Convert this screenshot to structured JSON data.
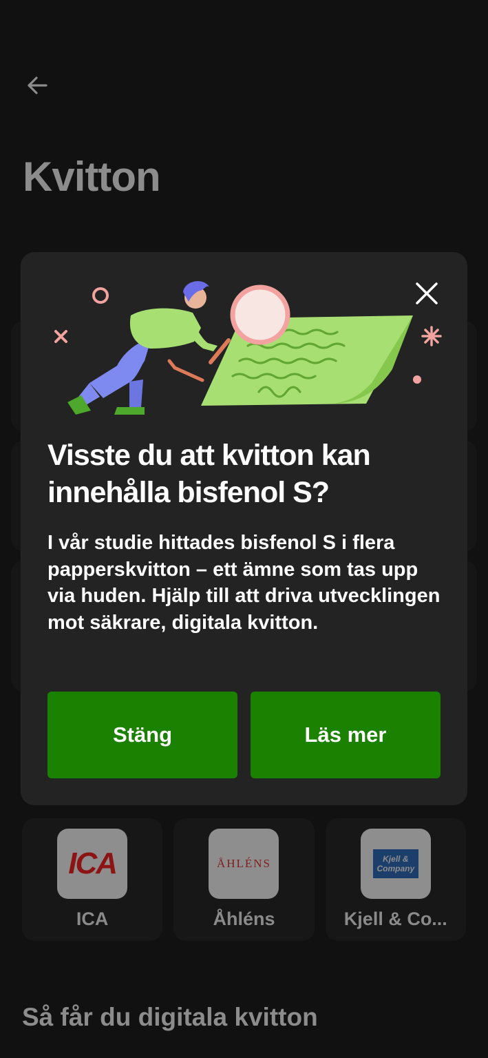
{
  "header": {
    "back_icon": "arrow-left-icon",
    "title": "Kvitton"
  },
  "stores": [
    {
      "name": "ICA",
      "logo_text": "ICA"
    },
    {
      "name": "Åhléns",
      "logo_text": "ÅHLÉNS"
    },
    {
      "name": "Kjell & Co...",
      "logo_line1": "Kjell &",
      "logo_line2": "Company"
    }
  ],
  "section": {
    "title": "Så får du digitala kvitton"
  },
  "modal": {
    "close_icon": "close-icon",
    "illustration": "person-with-magnifying-glass-over-receipt",
    "title": "Visste du att kvitton kan innehålla bisfenol S?",
    "body": "I vår studie hittades bisfenol S i flera papperskvitton – ett ämne som tas upp via huden. Hjälp till att driva utvecklingen mot säkrare, digitala kvitton.",
    "buttons": {
      "close": "Stäng",
      "read_more": "Läs mer"
    }
  },
  "colors": {
    "overlay": "#111111",
    "modal_bg": "#232323",
    "button_green": "#1a8200",
    "illustration_green": "#a7df73",
    "accent_pink": "#f2a3a0"
  }
}
